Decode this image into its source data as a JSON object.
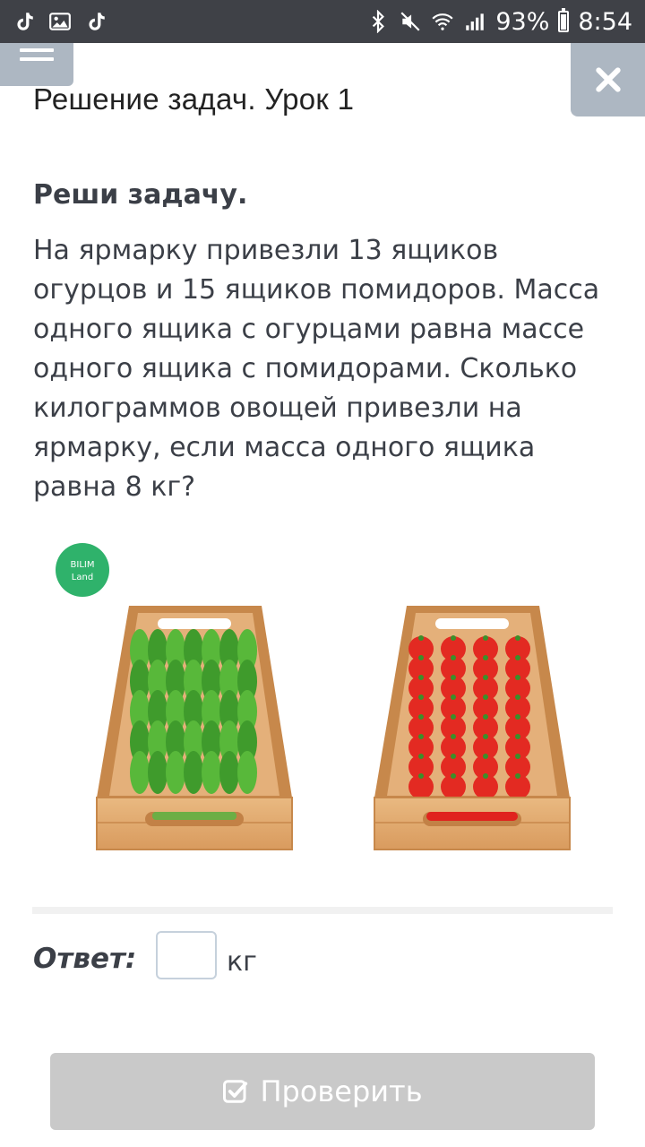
{
  "status_bar": {
    "left_icons": [
      "tiktok-icon",
      "gallery-icon",
      "tiktok-icon"
    ],
    "right_icons": [
      "bluetooth-icon",
      "mute-icon",
      "wifi-icon",
      "signal-icon"
    ],
    "battery": "93%",
    "battery_level": 0.93,
    "time": "8:54"
  },
  "header": {
    "menu_icon": "hamburger-menu-icon",
    "close_icon": "close-icon",
    "title": "Решение задач. Урок 1"
  },
  "task": {
    "heading": "Реши задачу.",
    "text": "На ярмарку привезли 13 ящиков\nогурцов и 15 ящиков помидоров. Масса\nодного ящика с огурцами равна массе\nодного ящика с помидорами. Сколько\nкилограммов овощей привезли на\nярмарку, если масса одного ящика\nравна 8 кг?"
  },
  "illustration": {
    "logo_text_1": "BILIM",
    "logo_text_2": "Land",
    "items": [
      "cucumber-crate",
      "tomato-crate"
    ]
  },
  "answer": {
    "label": "Ответ:",
    "value": "",
    "unit": "кг"
  },
  "check_button": {
    "label": "Проверить",
    "icon": "checkbox-check-icon"
  },
  "colors": {
    "status_bar": "#3f4147",
    "header_buttons": "#adb7c2",
    "text": "#3b3f47",
    "button_disabled": "#c9c9c9",
    "logo_green": "#2fb26b"
  }
}
